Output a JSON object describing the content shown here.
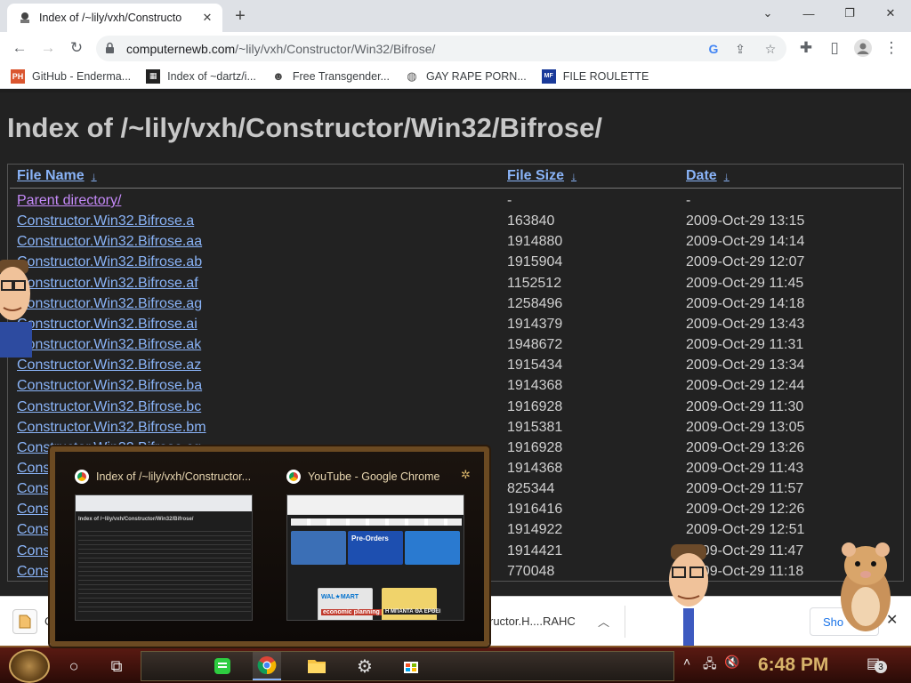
{
  "browser": {
    "tab_title": "Index of /~lily/vxh/Constructo",
    "url_host": "computernewb.com",
    "url_path": "/~lily/vxh/Constructor/Win32/Bifrose/"
  },
  "bookmarks": [
    {
      "label": "GitHub - Enderma...",
      "icon": "ph-icon"
    },
    {
      "label": "Index of ~dartz/i...",
      "icon": "grid-icon"
    },
    {
      "label": "Free Transgender...",
      "icon": "person-icon"
    },
    {
      "label": "GAY RAPE PORN...",
      "icon": "globe-icon"
    },
    {
      "label": "FILE ROULETTE",
      "icon": "mf-icon"
    }
  ],
  "page": {
    "heading": "Index of /~lily/vxh/Constructor/Win32/Bifrose/",
    "columns": {
      "name": "File Name",
      "size": "File Size",
      "date": "Date",
      "sort_glyph": "↓"
    },
    "rows": [
      {
        "name": "Parent directory/",
        "size": "-",
        "date": "-"
      },
      {
        "name": "Constructor.Win32.Bifrose.a",
        "size": "163840",
        "date": "2009-Oct-29 13:15"
      },
      {
        "name": "Constructor.Win32.Bifrose.aa",
        "size": "1914880",
        "date": "2009-Oct-29 14:14"
      },
      {
        "name": "Constructor.Win32.Bifrose.ab",
        "size": "1915904",
        "date": "2009-Oct-29 12:07"
      },
      {
        "name": "Constructor.Win32.Bifrose.af",
        "size": "1152512",
        "date": "2009-Oct-29 11:45"
      },
      {
        "name": "Constructor.Win32.Bifrose.ag",
        "size": "1258496",
        "date": "2009-Oct-29 14:18"
      },
      {
        "name": "Constructor.Win32.Bifrose.ai",
        "size": "1914379",
        "date": "2009-Oct-29 13:43"
      },
      {
        "name": "Constructor.Win32.Bifrose.ak",
        "size": "1948672",
        "date": "2009-Oct-29 11:31"
      },
      {
        "name": "Constructor.Win32.Bifrose.az",
        "size": "1915434",
        "date": "2009-Oct-29 13:34"
      },
      {
        "name": "Constructor.Win32.Bifrose.ba",
        "size": "1914368",
        "date": "2009-Oct-29 12:44"
      },
      {
        "name": "Constructor.Win32.Bifrose.bc",
        "size": "1916928",
        "date": "2009-Oct-29 11:30"
      },
      {
        "name": "Constructor.Win32.Bifrose.bm",
        "size": "1915381",
        "date": "2009-Oct-29 13:05"
      },
      {
        "name": "Constructor.Win32.Bifrose.cg",
        "size": "1916928",
        "date": "2009-Oct-29 13:26"
      },
      {
        "name": "Cons",
        "size": "1914368",
        "date": "2009-Oct-29 11:43"
      },
      {
        "name": "Cons",
        "size": "825344",
        "date": "2009-Oct-29 11:57"
      },
      {
        "name": "Cons",
        "size": "1916416",
        "date": "2009-Oct-29 12:26"
      },
      {
        "name": "Cons",
        "size": "1914922",
        "date": "2009-Oct-29 12:51"
      },
      {
        "name": "Cons",
        "size": "1914421",
        "date": "2009-Oct-29 11:47"
      },
      {
        "name": "Cons",
        "size": "770048",
        "date": "2009-Oct-29 11:18"
      }
    ]
  },
  "downloads": {
    "item1": "C",
    "item2": "ructor.H....RAHC",
    "show_all": "Sho"
  },
  "thumbnails": [
    {
      "title": "Index of /~lily/vxh/Constructor...",
      "mini_heading": "Index of /~lily/vxh/Constructor/Win32/Bifrose/"
    },
    {
      "title": "YouTube - Google Chrome",
      "card1": "Pre-Orders",
      "card2": "WAL★MART",
      "card3": "economic planning",
      "card4": "Η ΜΠΑΝΤΑ ΘΑ ΕΡΘΕΙ"
    }
  ],
  "taskbar": {
    "clock": "6:48 PM",
    "notification_count": "3"
  },
  "colors": {
    "link": "#8ab4f8",
    "visited": "#c58af9",
    "page_bg": "#222222",
    "taskbar": "#5a1a12",
    "clock": "#d8b46a"
  }
}
